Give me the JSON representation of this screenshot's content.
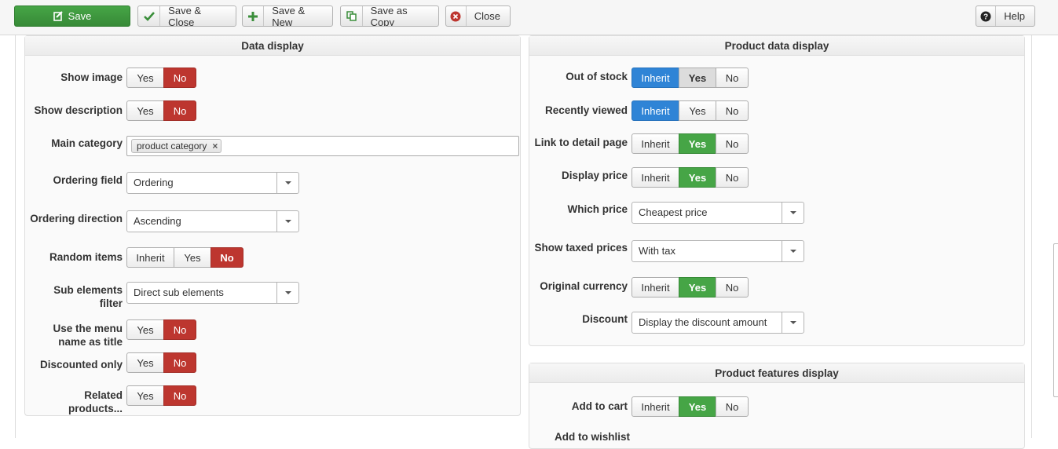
{
  "toolbar": {
    "save": "Save",
    "save_close": "Save & Close",
    "save_new": "Save & New",
    "save_copy": "Save as Copy",
    "close": "Close",
    "help": "Help"
  },
  "data_display": {
    "title": "Data display",
    "show_image": {
      "label": "Show image",
      "yes": "Yes",
      "no": "No",
      "selected": "No"
    },
    "show_description": {
      "label": "Show description",
      "yes": "Yes",
      "no": "No",
      "selected": "No"
    },
    "main_category": {
      "label": "Main category",
      "chip": "product category",
      "remove": "×"
    },
    "ordering_field": {
      "label": "Ordering field",
      "value": "Ordering"
    },
    "ordering_direction": {
      "label": "Ordering direction",
      "value": "Ascending"
    },
    "random_items": {
      "label": "Random items",
      "inherit": "Inherit",
      "yes": "Yes",
      "no": "No",
      "selected": "No"
    },
    "sub_elements_filter": {
      "label": "Sub elements filter",
      "value": "Direct sub elements"
    },
    "use_menu_name": {
      "label_line1": "Use the menu",
      "label_line2": "name as title",
      "yes": "Yes",
      "no": "No",
      "selected": "No"
    },
    "discounted_only": {
      "label": "Discounted only",
      "yes": "Yes",
      "no": "No",
      "selected": "No"
    },
    "related_products": {
      "label": "Related products...",
      "yes": "Yes",
      "no": "No",
      "selected": "No"
    }
  },
  "product_data_display": {
    "title": "Product data display",
    "out_of_stock": {
      "label": "Out of stock",
      "inherit": "Inherit",
      "yes": "Yes",
      "no": "No",
      "selected": "Inherit"
    },
    "recently_viewed": {
      "label": "Recently viewed",
      "inherit": "Inherit",
      "yes": "Yes",
      "no": "No",
      "selected": "Inherit"
    },
    "link_detail": {
      "label": "Link to detail page",
      "inherit": "Inherit",
      "yes": "Yes",
      "no": "No",
      "selected": "Yes"
    },
    "display_price": {
      "label": "Display price",
      "inherit": "Inherit",
      "yes": "Yes",
      "no": "No",
      "selected": "Yes"
    },
    "which_price": {
      "label": "Which price",
      "value": "Cheapest price"
    },
    "show_taxed": {
      "label": "Show taxed prices",
      "value": "With tax"
    },
    "original_currency": {
      "label": "Original currency",
      "inherit": "Inherit",
      "yes": "Yes",
      "no": "No",
      "selected": "Yes"
    },
    "discount": {
      "label": "Discount",
      "value": "Display the discount amount"
    }
  },
  "product_features_display": {
    "title": "Product features display",
    "add_to_cart": {
      "label": "Add to cart",
      "inherit": "Inherit",
      "yes": "Yes",
      "no": "No",
      "selected": "Yes"
    },
    "add_to_wishlist": {
      "label": "Add to wishlist"
    }
  },
  "colors": {
    "save_green": "#46a546",
    "no_red": "#bd362f",
    "inherit_blue": "#2f84d6"
  },
  "icons": {
    "save": "save-icon",
    "save_close": "check-icon",
    "save_new": "plus-icon",
    "save_copy": "copy-icon",
    "close": "close-circle-icon",
    "help": "question-icon",
    "select": "chevron-down-icon",
    "chip_remove": "remove-icon"
  }
}
